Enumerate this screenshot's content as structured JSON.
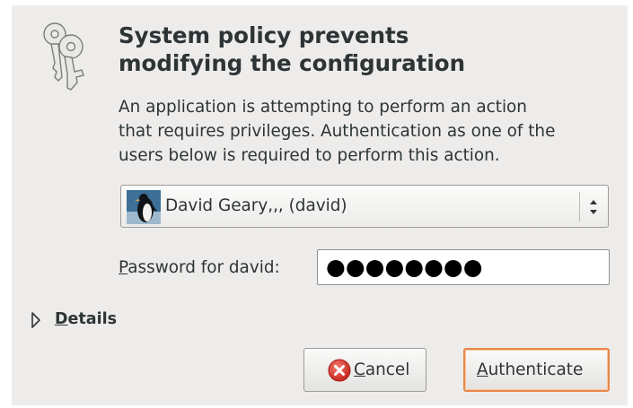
{
  "dialog": {
    "title_line1": "System policy prevents",
    "title_line2": "modifying the configuration",
    "message_line1": "An application is attempting to perform an action",
    "message_line2": "that requires privileges. Authentication as one of the",
    "message_line3": "users below is required to perform this action.",
    "icon": "keys-icon"
  },
  "user_select": {
    "selected": "David Geary,,, (david)",
    "avatar": "penguin-avatar",
    "arrow_icon": "up-down-arrows-icon"
  },
  "password": {
    "label_mnemonic": "P",
    "label_rest": "assword for david:",
    "masked_value": "●●●●●●●●"
  },
  "details": {
    "mnemonic": "D",
    "label_rest": "etails",
    "expanded": false
  },
  "buttons": {
    "cancel_mnemonic": "C",
    "cancel_rest": "ancel",
    "authenticate_mnemonic": "A",
    "authenticate_rest": "uthenticate"
  },
  "colors": {
    "dialog_bg": "#edeceb",
    "text": "#2e3436",
    "default_button_border": "#e8884a",
    "cancel_icon": "#d62c22"
  }
}
